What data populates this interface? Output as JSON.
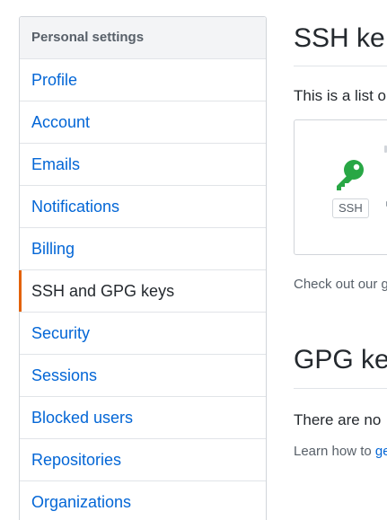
{
  "sidebar": {
    "header": "Personal settings",
    "items": [
      {
        "label": "Profile"
      },
      {
        "label": "Account"
      },
      {
        "label": "Emails"
      },
      {
        "label": "Notifications"
      },
      {
        "label": "Billing"
      },
      {
        "label": "SSH and GPG keys"
      },
      {
        "label": "Security"
      },
      {
        "label": "Sessions"
      },
      {
        "label": "Blocked users"
      },
      {
        "label": "Repositories"
      },
      {
        "label": "Organizations"
      }
    ],
    "selected": "SSH and GPG keys"
  },
  "main": {
    "ssh_title": "SSH ke",
    "ssh_intro": "This is a list o",
    "key_badge": "SSH",
    "ssh_help": "Check out our g",
    "gpg_title": "GPG ke",
    "gpg_empty": "There are no",
    "gpg_help_prefix": "Learn how to",
    "gpg_help_link": "ge"
  },
  "colors": {
    "link": "#0366d6",
    "selected_accent": "#e36209",
    "key_icon": "#28a745"
  },
  "icons": {
    "key": "key-icon"
  }
}
